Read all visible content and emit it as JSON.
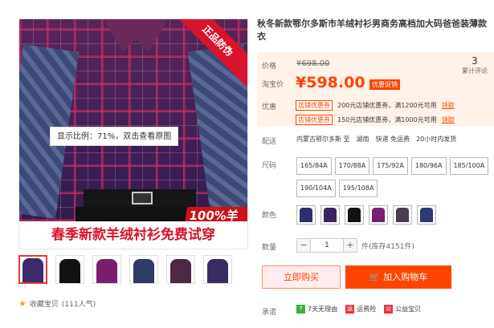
{
  "title": "秋冬新款鄂尔多斯市羊绒衬衫男商务高档加大码爸爸装薄款衣",
  "gallery": {
    "badge": "正品防伪",
    "zoom_tip": "显示比例：71%，双击查看原图",
    "wool_tag": "100%羊绒",
    "banner": "春季新款羊绒衬衫免费试穿",
    "thumb_colors": [
      "#3b2b6a",
      "#111111",
      "#7a1f6f",
      "#2c3a66",
      "#4b2a45",
      "#3a2c62"
    ],
    "favorite_label": "收藏宝贝",
    "favorite_count": "(111人气)"
  },
  "price": {
    "orig_label": "价格",
    "orig_value": "¥698.00",
    "promo_label": "淘宝价",
    "promo_value": "¥598.00",
    "promo_tag": "优惠促销",
    "review_num": "3",
    "review_label": "累计评论"
  },
  "coupons": {
    "label": "优惠",
    "items": [
      {
        "tag": "店铺优惠券",
        "text": "200元店铺优惠券，满1200元可用",
        "link": "领取"
      },
      {
        "tag": "店铺优惠券",
        "text": "150元店铺优惠券，满1000元可用",
        "link": "领取"
      }
    ]
  },
  "shipping": {
    "label": "配送",
    "from": "内蒙古鄂尔多斯 至",
    "to": "湖南",
    "express": "快递 免运费",
    "time": "20小时内发货"
  },
  "sizes": {
    "label": "尺码",
    "options": [
      "165/84A",
      "170/88A",
      "175/92A",
      "180/96A",
      "185/100A",
      "190/104A",
      "195/108A"
    ]
  },
  "colors": {
    "label": "颜色",
    "swatches": [
      "#2b2f6a",
      "#3a2460",
      "#121212",
      "#7a1f75",
      "#4a3b52",
      "#2c3a70"
    ]
  },
  "quantity": {
    "label": "数量",
    "minus": "−",
    "value": "1",
    "plus": "+",
    "stock": "件(库存4151件)"
  },
  "buttons": {
    "buy_now": "立即购买",
    "add_cart": "加入购物车"
  },
  "promise": {
    "label": "承诺",
    "items": [
      {
        "icon": "7",
        "text": "7天无理由",
        "color": "#3eb13e"
      },
      {
        "icon": "运",
        "text": "运费险",
        "color": "#e4393c"
      },
      {
        "icon": "公",
        "text": "公益宝贝",
        "color": "#e4393c"
      }
    ]
  }
}
